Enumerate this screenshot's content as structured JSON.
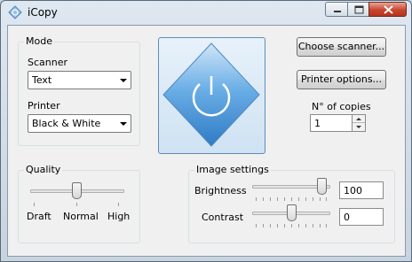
{
  "window": {
    "title": "iCopy"
  },
  "mode": {
    "title": "Mode",
    "scanner_label": "Scanner",
    "scanner_value": "Text",
    "printer_label": "Printer",
    "printer_value": "Black & White"
  },
  "actions": {
    "choose_scanner": "Choose scanner...",
    "printer_options": "Printer options...",
    "copies_label": "N° of copies",
    "copies_value": "1"
  },
  "quality": {
    "title": "Quality",
    "ticks": [
      "Draft",
      "Normal",
      "High"
    ],
    "level": 0.5
  },
  "image_settings": {
    "title": "Image settings",
    "brightness_label": "Brightness",
    "brightness_value": "100",
    "brightness_level": 1.0,
    "contrast_label": "Contrast",
    "contrast_value": "0",
    "contrast_level": 0.5
  },
  "colors": {
    "accent": "#3c87cd",
    "close_button": "#c7452f"
  }
}
